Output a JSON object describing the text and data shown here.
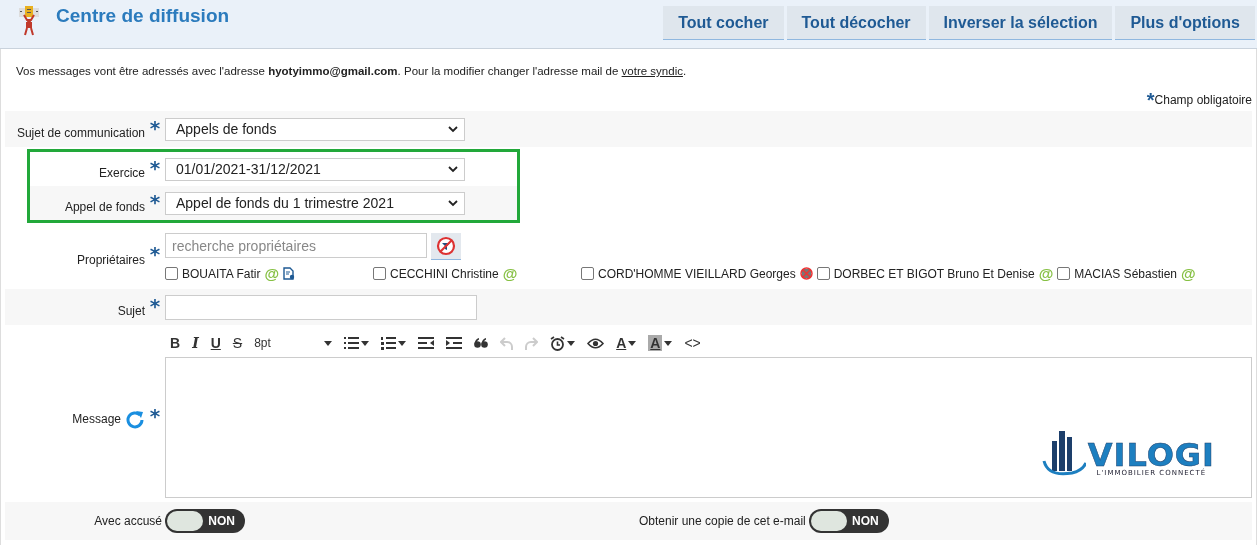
{
  "header": {
    "title": "Centre de diffusion",
    "buttons": [
      "Tout cocher",
      "Tout décocher",
      "Inverser la sélection",
      "Plus d'options"
    ]
  },
  "info": {
    "text": "Vos messages vont être adressés avec l'adresse **hyotyimmo@gmail.com**. Pour la modifier changer l'adresse mail de",
    "link": "votre syndic",
    "after": "."
  },
  "required_note": {
    "mark": "*",
    "text": "Champ obligatoire"
  },
  "fields": [
    {
      "label": "Sujet de communication",
      "required": "*",
      "kind": "select",
      "value": "Appels de fonds",
      "highlighted": false
    },
    {
      "label": "Exercice",
      "required": "*",
      "kind": "select",
      "value": "01/01/2021-31/12/2021",
      "highlighted": true
    },
    {
      "label": "Appel de fonds",
      "required": "*",
      "kind": "select",
      "value": "Appel de fonds du 1 trimestre 2021",
      "highlighted": true
    }
  ],
  "owners": {
    "label": "Propriétaires",
    "required": "*",
    "placeholder": "recherche propriétaires",
    "items": [
      {
        "name": "BOUAITA Fatir",
        "checked": false,
        "kind": "email",
        "mark": "@",
        "document": true
      },
      {
        "name": "CECCHINI Christine",
        "checked": false,
        "kind": "email",
        "mark": "@",
        "document": false
      },
      {
        "name": "CORD'HOMME VIEILLARD Georges",
        "checked": false,
        "kind": "no-email",
        "document": false
      },
      {
        "name": "DORBEC ET BIGOT Bruno Et Denise",
        "checked": false,
        "kind": "email",
        "mark": "@",
        "document": false
      },
      {
        "name": "MACIAS Sébastien",
        "checked": false,
        "kind": "email",
        "mark": "@",
        "document": false
      }
    ]
  },
  "subject": {
    "label": "Sujet",
    "required": "*"
  },
  "message": {
    "label": "Message",
    "required": "*",
    "toolbar": [
      {
        "kind": "bold",
        "label": "B"
      },
      {
        "kind": "italic",
        "label": "I"
      },
      {
        "kind": "underline",
        "label": "U"
      },
      {
        "kind": "strike",
        "label": "S"
      },
      {
        "kind": "size",
        "label": "8pt"
      },
      {
        "kind": "bullet-list",
        "dropdown": true
      },
      {
        "kind": "number-list",
        "dropdown": true
      },
      {
        "kind": "outdent"
      },
      {
        "kind": "indent"
      },
      {
        "kind": "quote"
      },
      {
        "kind": "undo",
        "disabled": true
      },
      {
        "kind": "redo",
        "disabled": true
      },
      {
        "kind": "clock",
        "dropdown": true
      },
      {
        "kind": "eye"
      },
      {
        "kind": "text-color",
        "label": "A",
        "dropdown": true
      },
      {
        "kind": "highlight",
        "label": "A",
        "dropdown": true
      },
      {
        "kind": "code",
        "label": "<>"
      }
    ],
    "logo": {
      "name": "VILOGI",
      "tagline": "L'IMMOBILIER CONNECTÉ"
    }
  },
  "toggles": [
    {
      "label": "Avec accusé",
      "on": false,
      "state_text": "NON"
    },
    {
      "label": "Obtenir une copie de cet e-mail",
      "on": false,
      "state_text": "NON"
    }
  ]
}
